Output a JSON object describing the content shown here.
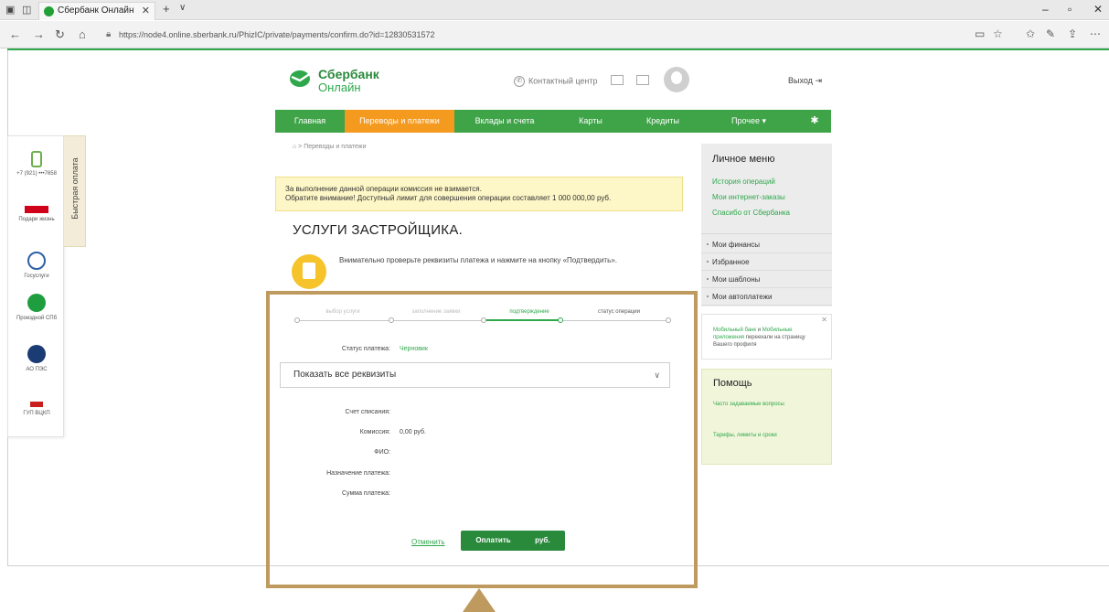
{
  "browser": {
    "tab_title": "Сбербанк Онлайн",
    "url": "https://node4.online.sberbank.ru/PhizIC/private/payments/confirm.do?id=12830531572"
  },
  "quick_panel": {
    "title": "Быстрая оплата",
    "items": [
      {
        "label": "+7 (921) •••7658",
        "icon": "phone-icon",
        "color": "#6ab04c"
      },
      {
        "label": "Подари жизнь",
        "icon": "charity-icon",
        "color": "#d0021b"
      },
      {
        "label": "Госуслуги",
        "icon": "gosuslugi-icon",
        "color": "#2f5fa7"
      },
      {
        "label": "Проездной СПб",
        "icon": "bus-icon",
        "color": "#1e9e3e"
      },
      {
        "label": "АО ПЭС",
        "icon": "pes-icon",
        "color": "#1a3b73"
      },
      {
        "label": "ГУП ВЦКП",
        "icon": "vckp-icon",
        "color": "#c81e1e"
      }
    ]
  },
  "header": {
    "logo_line1": "Сбербанк",
    "logo_line2": "Онлайн",
    "contact": "Контактный центр",
    "logout": "Выход"
  },
  "nav": {
    "items": [
      "Главная",
      "Переводы и платежи",
      "Вклады и счета",
      "Карты",
      "Кредиты",
      "Прочее"
    ],
    "active_index": 1,
    "more_arrow": "▾"
  },
  "breadcrumb": "Переводы и платежи",
  "notice": {
    "line1": "За выполнение данной операции комиссия не взимается.",
    "line2": "Обратите внимание! Доступный лимит для совершения операции составляет 1 000 000,00 руб."
  },
  "page_title": "УСЛУГИ ЗАСТРОЙЩИКА.",
  "hint": "Внимательно проверьте реквизиты платежа и нажмите на кнопку «Подтвердить».",
  "steps": [
    "выбор услуги",
    "заполнение заявки",
    "подтверждение",
    "статус операции"
  ],
  "current_step": 2,
  "status": {
    "label": "Статус платежа:",
    "value": "Черновик"
  },
  "show_details": "Показать все реквизиты",
  "fields": [
    {
      "label": "Счет списания:",
      "value": ""
    },
    {
      "label": "Комиссия:",
      "value": "0,00 руб."
    },
    {
      "label": "ФИО:",
      "value": ""
    },
    {
      "label": "Назначение платежа:",
      "value": ""
    },
    {
      "label": "Сумма платежа:",
      "value": ""
    }
  ],
  "actions": {
    "cancel": "Отменить",
    "pay_prefix": "Оплатить",
    "pay_suffix": "руб."
  },
  "sidebar": {
    "title": "Личное меню",
    "links": [
      "История операций",
      "Мои интернет-заказы",
      "Спасибо от Сбербанка"
    ],
    "items": [
      "Мои финансы",
      "Избранное",
      "Мои шаблоны",
      "Мои автоплатежи"
    ],
    "promo_a": "Мобильный банк",
    "promo_and": " и ",
    "promo_b": "Мобильные приложения",
    "promo_rest": " переехали на страницу Вашего профиля",
    "help_title": "Помощь",
    "help_links": [
      "Часто задаваемые вопросы",
      "Тарифы, лимиты и сроки"
    ]
  },
  "colors": {
    "brand_green": "#2ea84b",
    "nav_active": "#f49a1e",
    "highlight": "#bf9a5f"
  }
}
